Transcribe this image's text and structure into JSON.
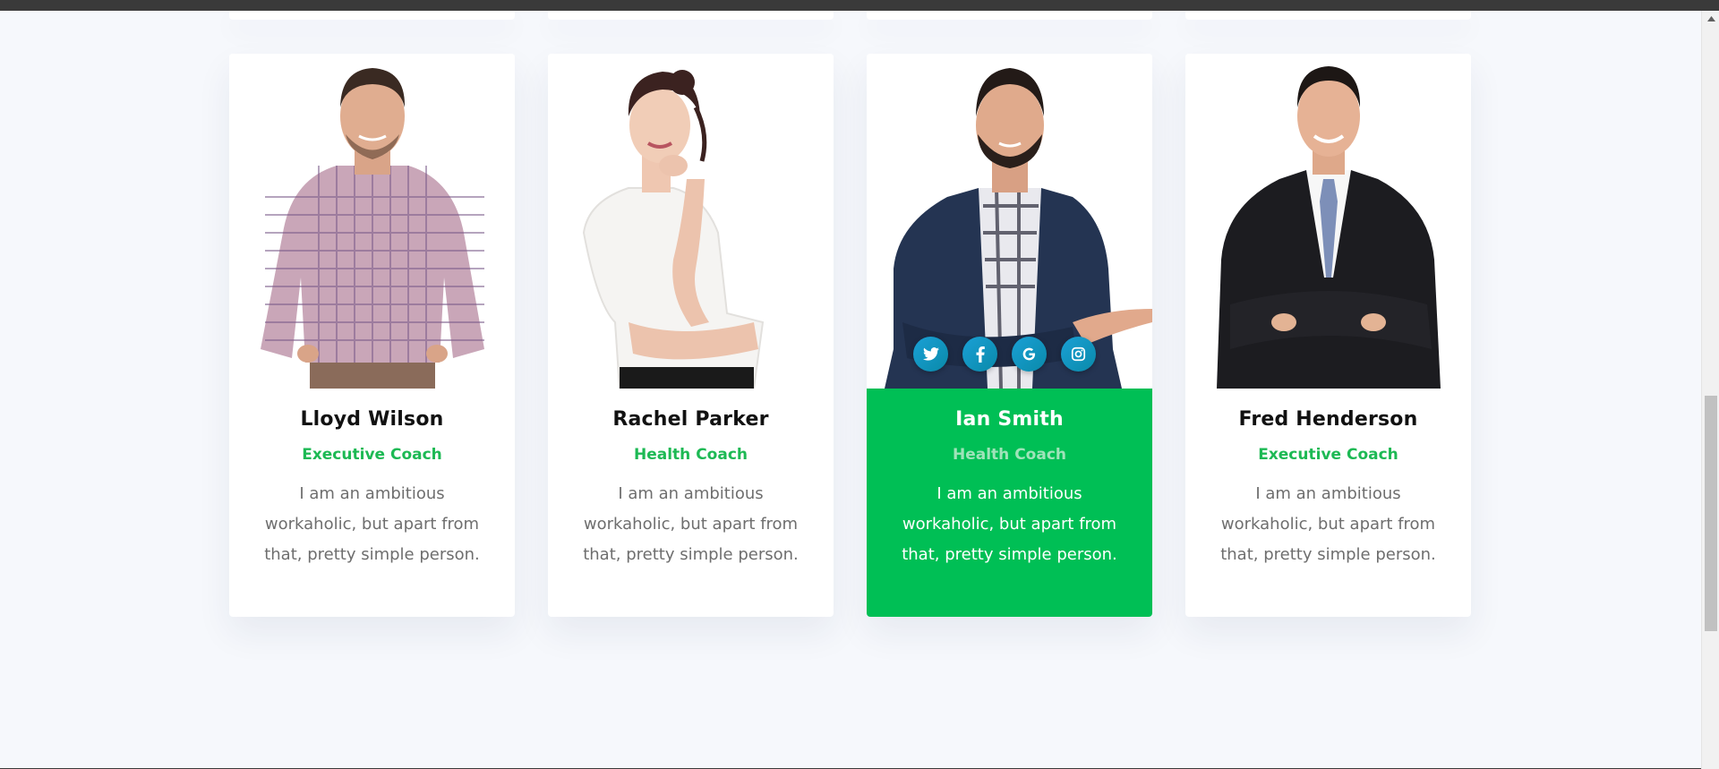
{
  "team": [
    {
      "name": "Lloyd Wilson",
      "role": "Executive Coach",
      "bio": "I am an ambitious workaholic, but apart from that, pretty simple person.",
      "active": false
    },
    {
      "name": "Rachel Parker",
      "role": "Health Coach",
      "bio": "I am an ambitious workaholic, but apart from that, pretty simple person.",
      "active": false
    },
    {
      "name": "Ian Smith",
      "role": "Health Coach",
      "bio": "I am an ambitious workaholic, but apart from that, pretty simple person.",
      "active": true,
      "social": [
        "twitter-icon",
        "facebook-icon",
        "google-icon",
        "instagram-icon"
      ]
    },
    {
      "name": "Fred Henderson",
      "role": "Executive Coach",
      "bio": "I am an ambitious workaholic, but apart from that, pretty simple person.",
      "active": false
    }
  ],
  "colors": {
    "accent": "#00bf55",
    "role_text": "#1db954",
    "social": "#1aa0d6",
    "background": "#f6f8fc"
  }
}
